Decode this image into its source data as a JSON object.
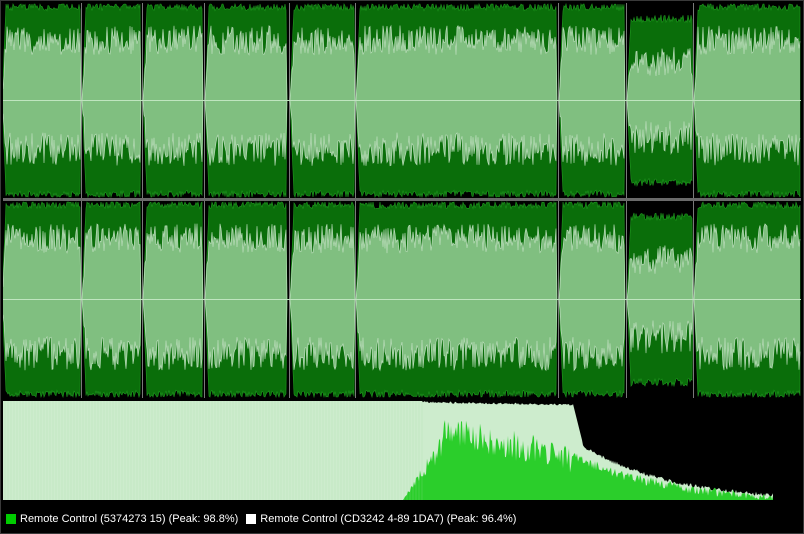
{
  "colors": {
    "background": "#000000",
    "wave_dark": "#0a6e0a",
    "wave_outline": "#1f9a1f",
    "wave_light": "#80bf80",
    "wave_light_edge": "#d6ecd6",
    "center_line": "#bfe5bf",
    "spectrum_light": "#cdeccd",
    "spectrum_bright": "#22cc22",
    "track_separator": "#dddddd"
  },
  "legend": {
    "items": [
      {
        "label": "Remote Control (5374273 15) (Peak: 98.8%)",
        "color": "#00cc00"
      },
      {
        "label": "Remote Control (CD3242 4-89 1DA7) (Peak: 96.4%)",
        "color": "#ffffff"
      }
    ]
  }
}
